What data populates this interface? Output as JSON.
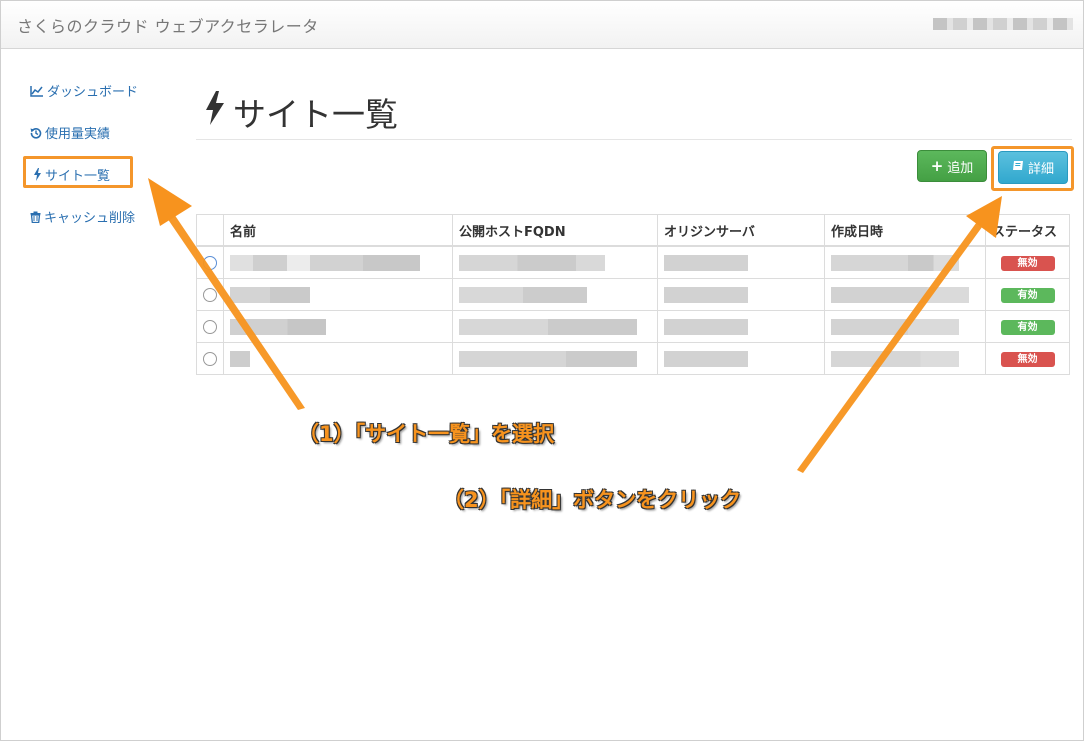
{
  "app": {
    "title": "さくらのクラウド ウェブアクセラレータ"
  },
  "sidebar": {
    "items": [
      {
        "label": "ダッシュボード",
        "icon": "line-chart-icon"
      },
      {
        "label": "使用量実績",
        "icon": "history-icon"
      },
      {
        "label": "サイト一覧",
        "icon": "bolt-icon",
        "active": true
      },
      {
        "label": "キャッシュ削除",
        "icon": "trash-icon"
      }
    ]
  },
  "page": {
    "title": "サイト一覧",
    "title_icon": "bolt-icon"
  },
  "toolbar": {
    "add_label": "追加",
    "detail_label": "詳細"
  },
  "table": {
    "columns": [
      "名前",
      "公開ホストFQDN",
      "オリジンサーバ",
      "作成日時",
      "ステータス"
    ],
    "rows": [
      {
        "status": "無効",
        "selected": true
      },
      {
        "status": "有効",
        "selected": false
      },
      {
        "status": "有効",
        "selected": false
      },
      {
        "status": "無効",
        "selected": false
      }
    ]
  },
  "annotations": {
    "step1": "（1）「サイト一覧」を選択",
    "step2": "（2）「詳細」ボタンをクリック"
  },
  "colors": {
    "accent_orange": "#f7931e",
    "success": "#5cb85c",
    "danger": "#d9534f",
    "info": "#5bc0de",
    "link": "#2a6fb0"
  }
}
